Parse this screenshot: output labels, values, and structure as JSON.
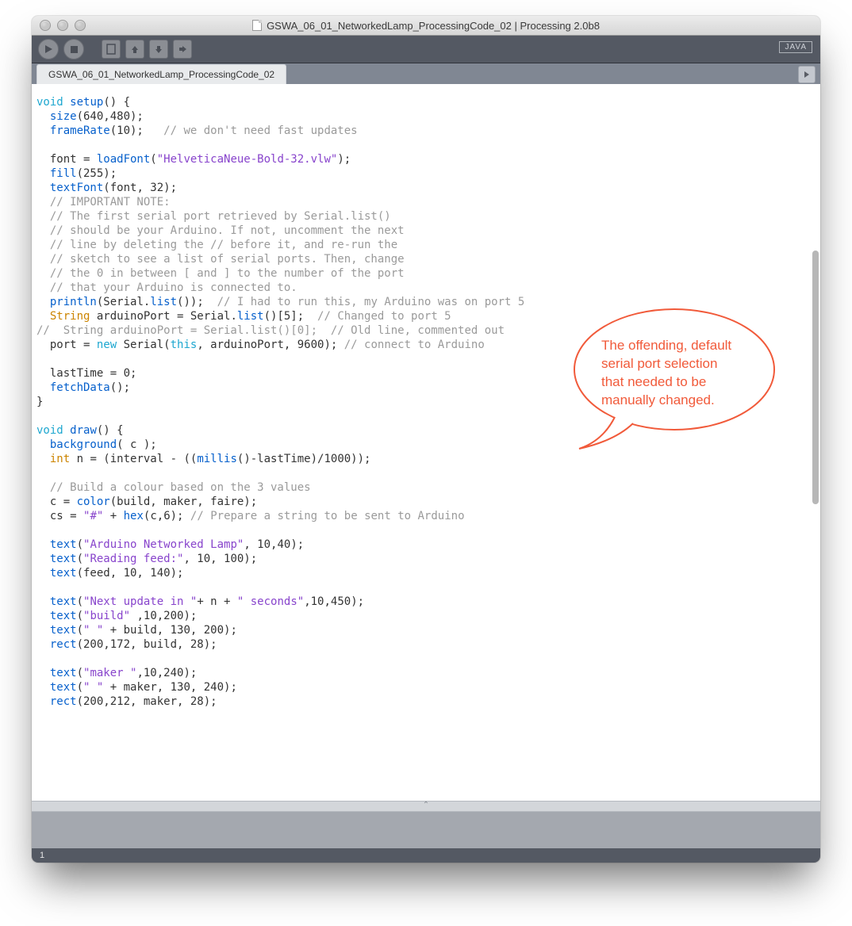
{
  "window": {
    "title": "GSWA_06_01_NetworkedLamp_ProcessingCode_02 | Processing 2.0b8"
  },
  "toolbar": {
    "mode": "JAVA"
  },
  "tabs": {
    "active": "GSWA_06_01_NetworkedLamp_ProcessingCode_02"
  },
  "status": {
    "line": "1"
  },
  "annotation": {
    "l1": "The offending, default",
    "l2": "serial port selection",
    "l3": "that needed to be",
    "l4": "manually changed."
  },
  "code": {
    "l01_a": "void",
    "l01_b": " ",
    "l01_c": "setup",
    "l01_d": "() {",
    "l02_a": "  ",
    "l02_b": "size",
    "l02_c": "(640,480);",
    "l03_a": "  ",
    "l03_b": "frameRate",
    "l03_c": "(10);   ",
    "l03_d": "// we don't need fast updates",
    "l04": "",
    "l05_a": "  font = ",
    "l05_b": "loadFont",
    "l05_c": "(",
    "l05_d": "\"HelveticaNeue-Bold-32.vlw\"",
    "l05_e": ");",
    "l06_a": "  ",
    "l06_b": "fill",
    "l06_c": "(255);",
    "l07_a": "  ",
    "l07_b": "textFont",
    "l07_c": "(font, 32);",
    "l08": "  // IMPORTANT NOTE:",
    "l09": "  // The first serial port retrieved by Serial.list()",
    "l10": "  // should be your Arduino. If not, uncomment the next",
    "l11": "  // line by deleting the // before it, and re-run the",
    "l12": "  // sketch to see a list of serial ports. Then, change",
    "l13": "  // the 0 in between [ and ] to the number of the port",
    "l14": "  // that your Arduino is connected to.",
    "l15_a": "  ",
    "l15_b": "println",
    "l15_c": "(Serial.",
    "l15_d": "list",
    "l15_e": "());  ",
    "l15_f": "// I had to run this, my Arduino was on port 5",
    "l16_a": "  ",
    "l16_b": "String",
    "l16_c": " arduinoPort = Serial.",
    "l16_d": "list",
    "l16_e": "()[5];  ",
    "l16_f": "// Changed to port 5",
    "l17": "//  String arduinoPort = Serial.list()[0];  // Old line, commented out",
    "l18_a": "  port = ",
    "l18_b": "new",
    "l18_c": " Serial(",
    "l18_d": "this",
    "l18_e": ", arduinoPort, 9600); ",
    "l18_f": "// connect to Arduino",
    "l19": "",
    "l20": "  lastTime = 0;",
    "l21_a": "  ",
    "l21_b": "fetchData",
    "l21_c": "();",
    "l22": "}",
    "l23": "",
    "l24_a": "void",
    "l24_b": " ",
    "l24_c": "draw",
    "l24_d": "() {",
    "l25_a": "  ",
    "l25_b": "background",
    "l25_c": "( c );",
    "l26_a": "  ",
    "l26_b": "int",
    "l26_c": " n = (interval - ((",
    "l26_d": "millis",
    "l26_e": "()-lastTime)/1000));",
    "l27": "",
    "l28": "  // Build a colour based on the 3 values",
    "l29_a": "  c = ",
    "l29_b": "color",
    "l29_c": "(build, maker, faire);",
    "l30_a": "  cs = ",
    "l30_b": "\"#\"",
    "l30_c": " + ",
    "l30_d": "hex",
    "l30_e": "(c,6); ",
    "l30_f": "// Prepare a string to be sent to Arduino",
    "l31": "",
    "l32_a": "  ",
    "l32_b": "text",
    "l32_c": "(",
    "l32_d": "\"Arduino Networked Lamp\"",
    "l32_e": ", 10,40);",
    "l33_a": "  ",
    "l33_b": "text",
    "l33_c": "(",
    "l33_d": "\"Reading feed:\"",
    "l33_e": ", 10, 100);",
    "l34_a": "  ",
    "l34_b": "text",
    "l34_c": "(feed, 10, 140);",
    "l35": "",
    "l36_a": "  ",
    "l36_b": "text",
    "l36_c": "(",
    "l36_d": "\"Next update in \"",
    "l36_e": "+ n + ",
    "l36_f": "\" seconds\"",
    "l36_g": ",10,450);",
    "l37_a": "  ",
    "l37_b": "text",
    "l37_c": "(",
    "l37_d": "\"build\"",
    "l37_e": " ,10,200);",
    "l38_a": "  ",
    "l38_b": "text",
    "l38_c": "(",
    "l38_d": "\" \"",
    "l38_e": " + build, 130, 200);",
    "l39_a": "  ",
    "l39_b": "rect",
    "l39_c": "(200,172, build, 28);",
    "l40": "",
    "l41_a": "  ",
    "l41_b": "text",
    "l41_c": "(",
    "l41_d": "\"maker \"",
    "l41_e": ",10,240);",
    "l42_a": "  ",
    "l42_b": "text",
    "l42_c": "(",
    "l42_d": "\" \"",
    "l42_e": " + maker, 130, 240);",
    "l43_a": "  ",
    "l43_b": "rect",
    "l43_c": "(200,212, maker, 28);"
  }
}
